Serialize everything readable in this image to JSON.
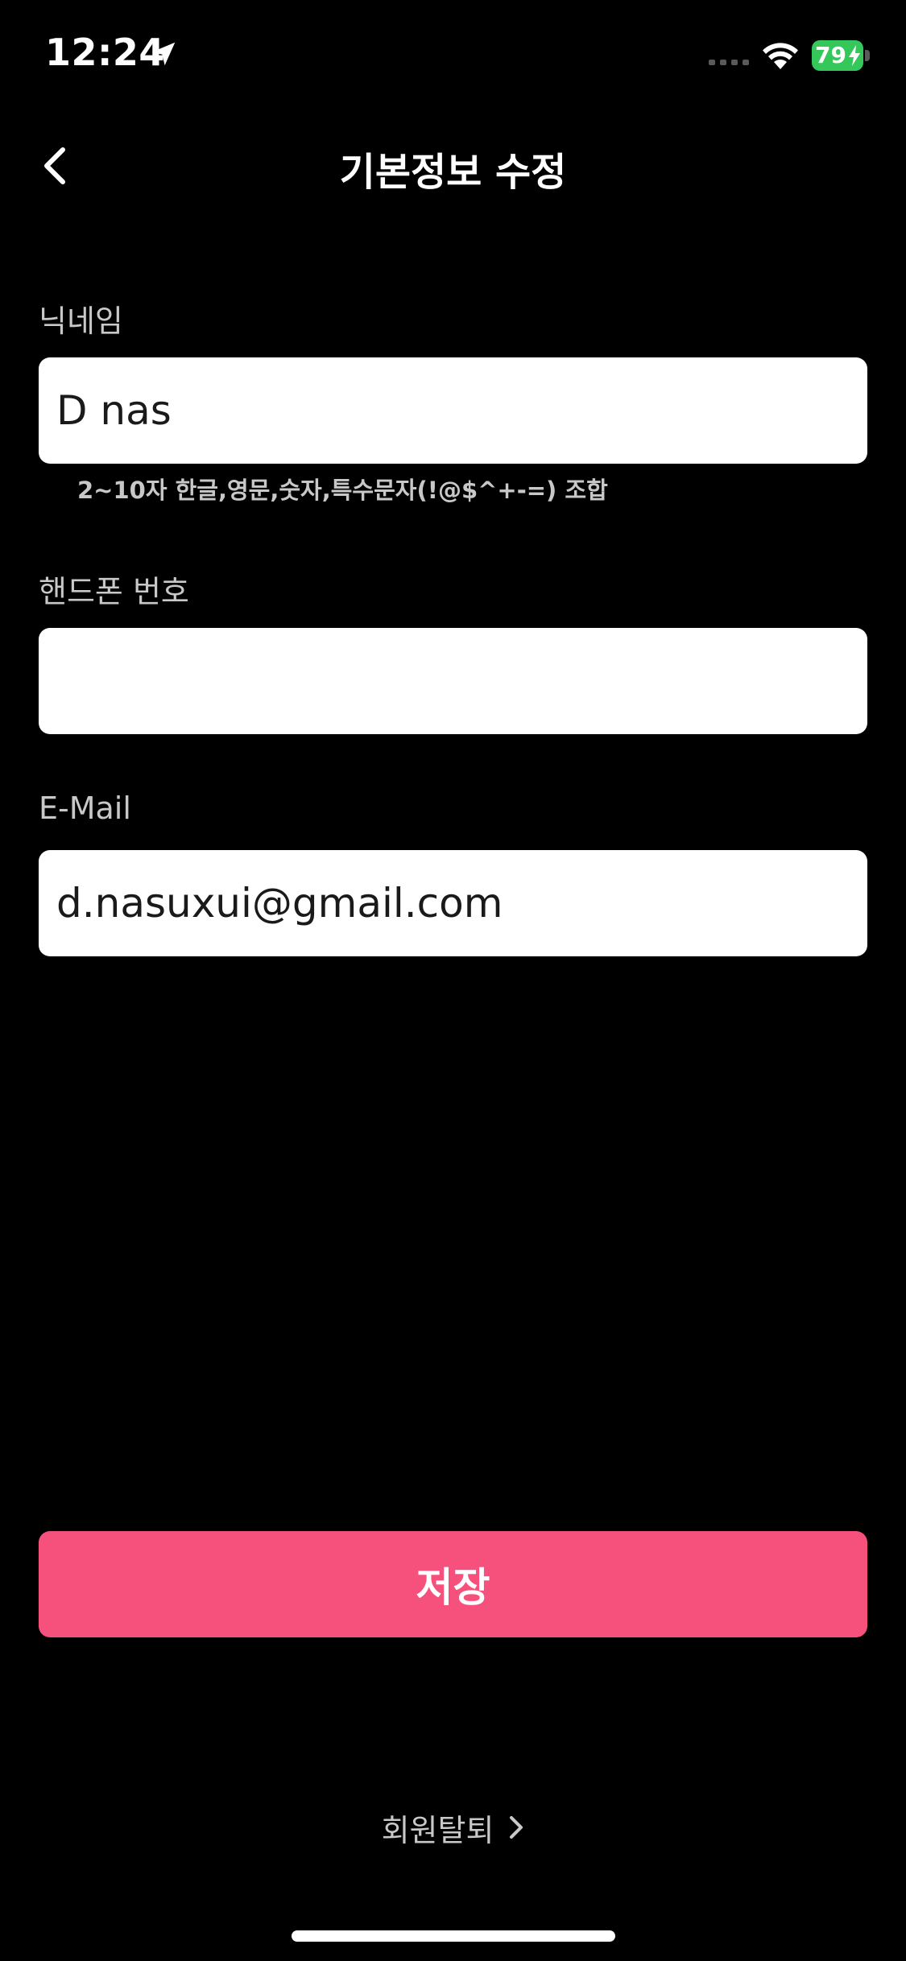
{
  "status_bar": {
    "time": "12:24",
    "battery_level": "79",
    "battery_charging": true,
    "icons": [
      "location-arrow-icon",
      "cellular-signal-icon",
      "wifi-icon",
      "battery-icon"
    ]
  },
  "header": {
    "title": "기본정보 수정",
    "back_icon": "chevron-left-icon"
  },
  "form": {
    "nickname": {
      "label": "닉네임",
      "value": "D nas",
      "hint": "2~10자 한글,영문,숫자,특수문자(!@$^+-=) 조합"
    },
    "phone": {
      "label": "핸드폰 번호",
      "value": ""
    },
    "email": {
      "label": "E-Mail",
      "value": "d.nasuxui@gmail.com"
    }
  },
  "actions": {
    "save_label": "저장",
    "withdraw_label": "회원탈퇴",
    "withdraw_icon": "chevron-right-icon"
  },
  "colors": {
    "background": "#000000",
    "accent": "#f5517c",
    "input_background": "#ffffff",
    "label": "#c8c8c8",
    "battery": "#34c759"
  }
}
